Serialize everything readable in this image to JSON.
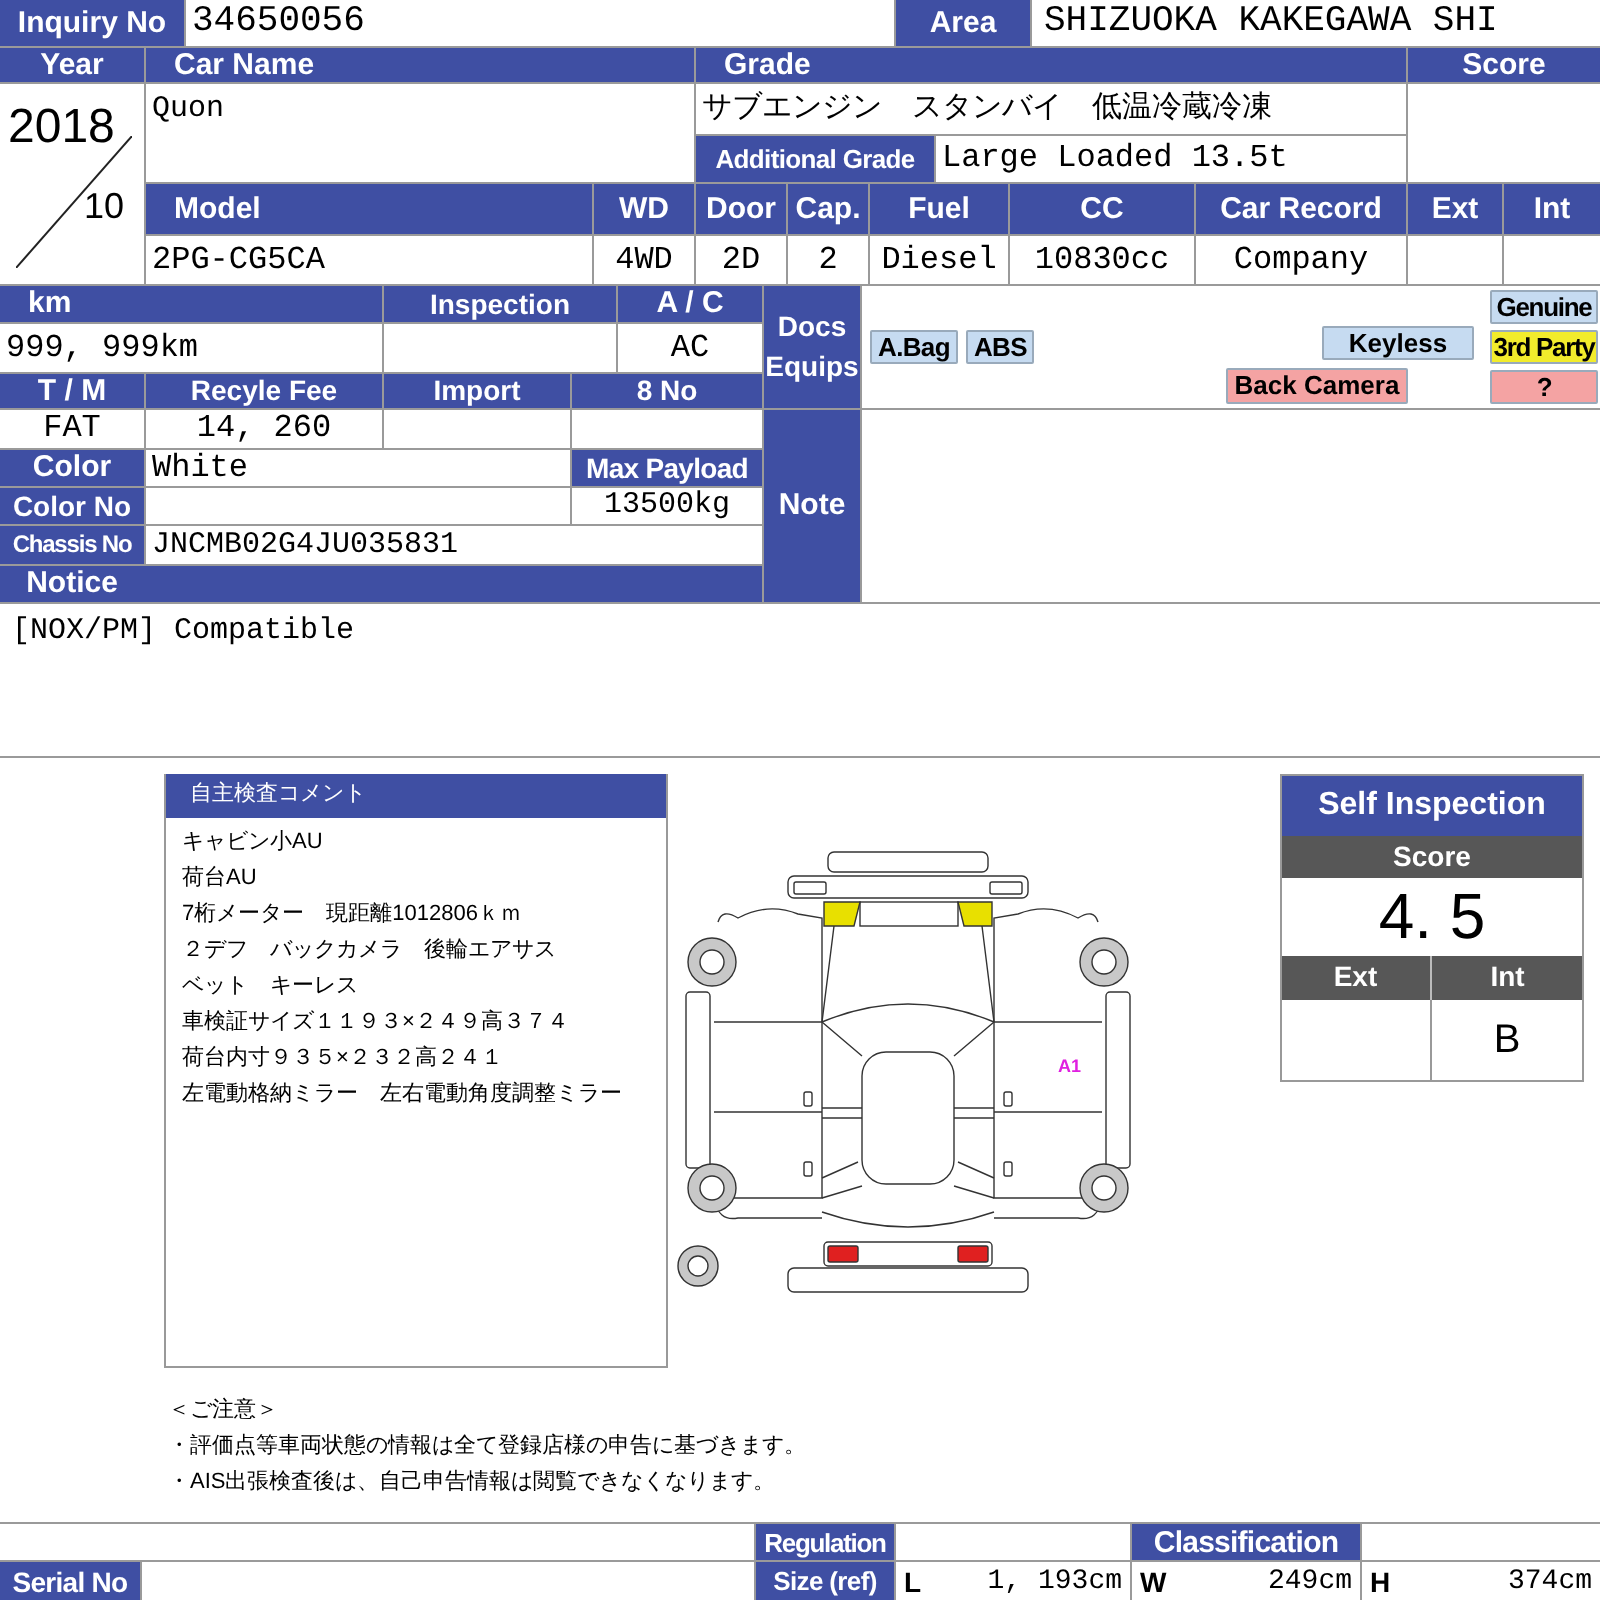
{
  "inquiry": {
    "label": "Inquiry No",
    "value": "34650056"
  },
  "area": {
    "label": "Area",
    "value": "SHIZUOKA KAKEGAWA SHI"
  },
  "year": {
    "label": "Year",
    "year": "2018",
    "month": "10"
  },
  "car_name": {
    "label": "Car Name",
    "value": "Quon"
  },
  "grade": {
    "label": "Grade",
    "value": "サブエンジン　スタンバイ　低温冷蔵冷凍",
    "additional_label": "Additional Grade",
    "additional_value": "Large Loaded 13.5t"
  },
  "score": {
    "label": "Score"
  },
  "specs": [
    {
      "label": "Model",
      "value": "2PG-CG5CA"
    },
    {
      "label": "WD",
      "value": "4WD"
    },
    {
      "label": "Door",
      "value": "2D"
    },
    {
      "label": "Cap.",
      "value": "2"
    },
    {
      "label": "Fuel",
      "value": "Diesel"
    },
    {
      "label": "CC",
      "value": "10830cc"
    },
    {
      "label": "Car Record",
      "value": "Company"
    },
    {
      "label": "Ext"
    },
    {
      "label": "Int"
    }
  ],
  "km": {
    "label": "km",
    "value": "999, 999km"
  },
  "inspection": {
    "label": "Inspection"
  },
  "ac": {
    "label": "A / C",
    "value": "AC"
  },
  "tm": {
    "label": "T / M",
    "value": "FAT"
  },
  "recycle_fee": {
    "label": "Recyle Fee",
    "value": "14, 260"
  },
  "import": {
    "label": "Import"
  },
  "eight_no": {
    "label": "8 No"
  },
  "color": {
    "label": "Color",
    "value": "White"
  },
  "max_payload": {
    "label": "Max Payload",
    "value": "13500kg"
  },
  "color_no": {
    "label": "Color No"
  },
  "chassis_no": {
    "label": "Chassis No",
    "value": "JNCMB02G4JU035831"
  },
  "docs_equips": {
    "label_1": "Docs",
    "label_2": "Equips",
    "equipment": [
      {
        "label": "A.Bag",
        "color": "#c6dbf1"
      },
      {
        "label": "ABS",
        "color": "#c6dbf1"
      }
    ],
    "options": [
      {
        "label": "Keyless",
        "color": "#c6dbf1"
      },
      {
        "label": "Back Camera",
        "color": "#f4a3a3"
      }
    ],
    "parts_origin": [
      {
        "label": "Genuine",
        "color": "#c6dbf1"
      },
      {
        "label": "3rd Party",
        "color": "#f2ec2c"
      },
      {
        "label": "?",
        "color": "#f4a3a3"
      }
    ]
  },
  "note": {
    "label": "Note"
  },
  "notice": {
    "label": "Notice",
    "value": "[NOX/PM] Compatible"
  },
  "comment": {
    "title": "自主検査コメント",
    "lines": [
      "キャビン小AU",
      "荷台AU",
      "7桁メーター　現距離1012806ｋｍ",
      "２デフ　バックカメラ　後輪エアサス",
      "ベット　キーレス",
      "車検証サイズ１１９３×２４９高３７４",
      "荷台内寸９３５×２３２高２４１",
      "左電動格納ミラー　左右電動角度調整ミラー"
    ]
  },
  "diagram": {
    "marks": [
      {
        "label": "A1",
        "color": "#e020e0"
      }
    ]
  },
  "self_inspection": {
    "title": "Self Inspection",
    "score_label": "Score",
    "score": "4. 5",
    "ext_label": "Ext",
    "int_label": "Int",
    "int": "B"
  },
  "caution": [
    "＜ご注意＞",
    "・評価点等車両状態の情報は全て登録店様の申告に基づきます。",
    "・AIS出張検査後は、自己申告情報は閲覧できなくなります。"
  ],
  "regulation": {
    "label": "Regulation"
  },
  "classification": {
    "label": "Classification"
  },
  "serial_no": {
    "label": "Serial No"
  },
  "size": {
    "label": "Size (ref)",
    "l_label": "L",
    "l": "1, 193cm",
    "w_label": "W",
    "w": "249cm",
    "h_label": "H",
    "h": "374cm"
  }
}
